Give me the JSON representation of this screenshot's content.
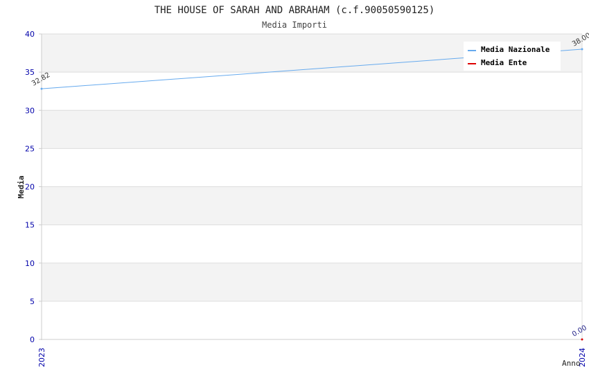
{
  "chart_data": {
    "type": "line",
    "title": "THE HOUSE OF SARAH AND ABRAHAM (c.f.90050590125)",
    "subtitle": "Media Importi",
    "xlabel": "Anno",
    "ylabel": "Media",
    "x": [
      "2023",
      "2024"
    ],
    "ylim": [
      0,
      40
    ],
    "yticks": [
      "0",
      "5",
      "10",
      "15",
      "20",
      "25",
      "30",
      "35",
      "40"
    ],
    "grid": true,
    "legend_position": "top-right",
    "series": [
      {
        "name": "Media Nazionale",
        "color": "#66aaee",
        "values": [
          32.82,
          38.0
        ],
        "labels": [
          "32.82",
          "38.00"
        ]
      },
      {
        "name": "Media Ente",
        "color": "#dd0000",
        "values": [
          null,
          0.0
        ],
        "labels": [
          "",
          "0.00"
        ]
      }
    ],
    "colors": {
      "band": "#f3f3f3",
      "gridline": "#dddddd",
      "tick_label": "#0000aa",
      "title": "#222222"
    }
  }
}
